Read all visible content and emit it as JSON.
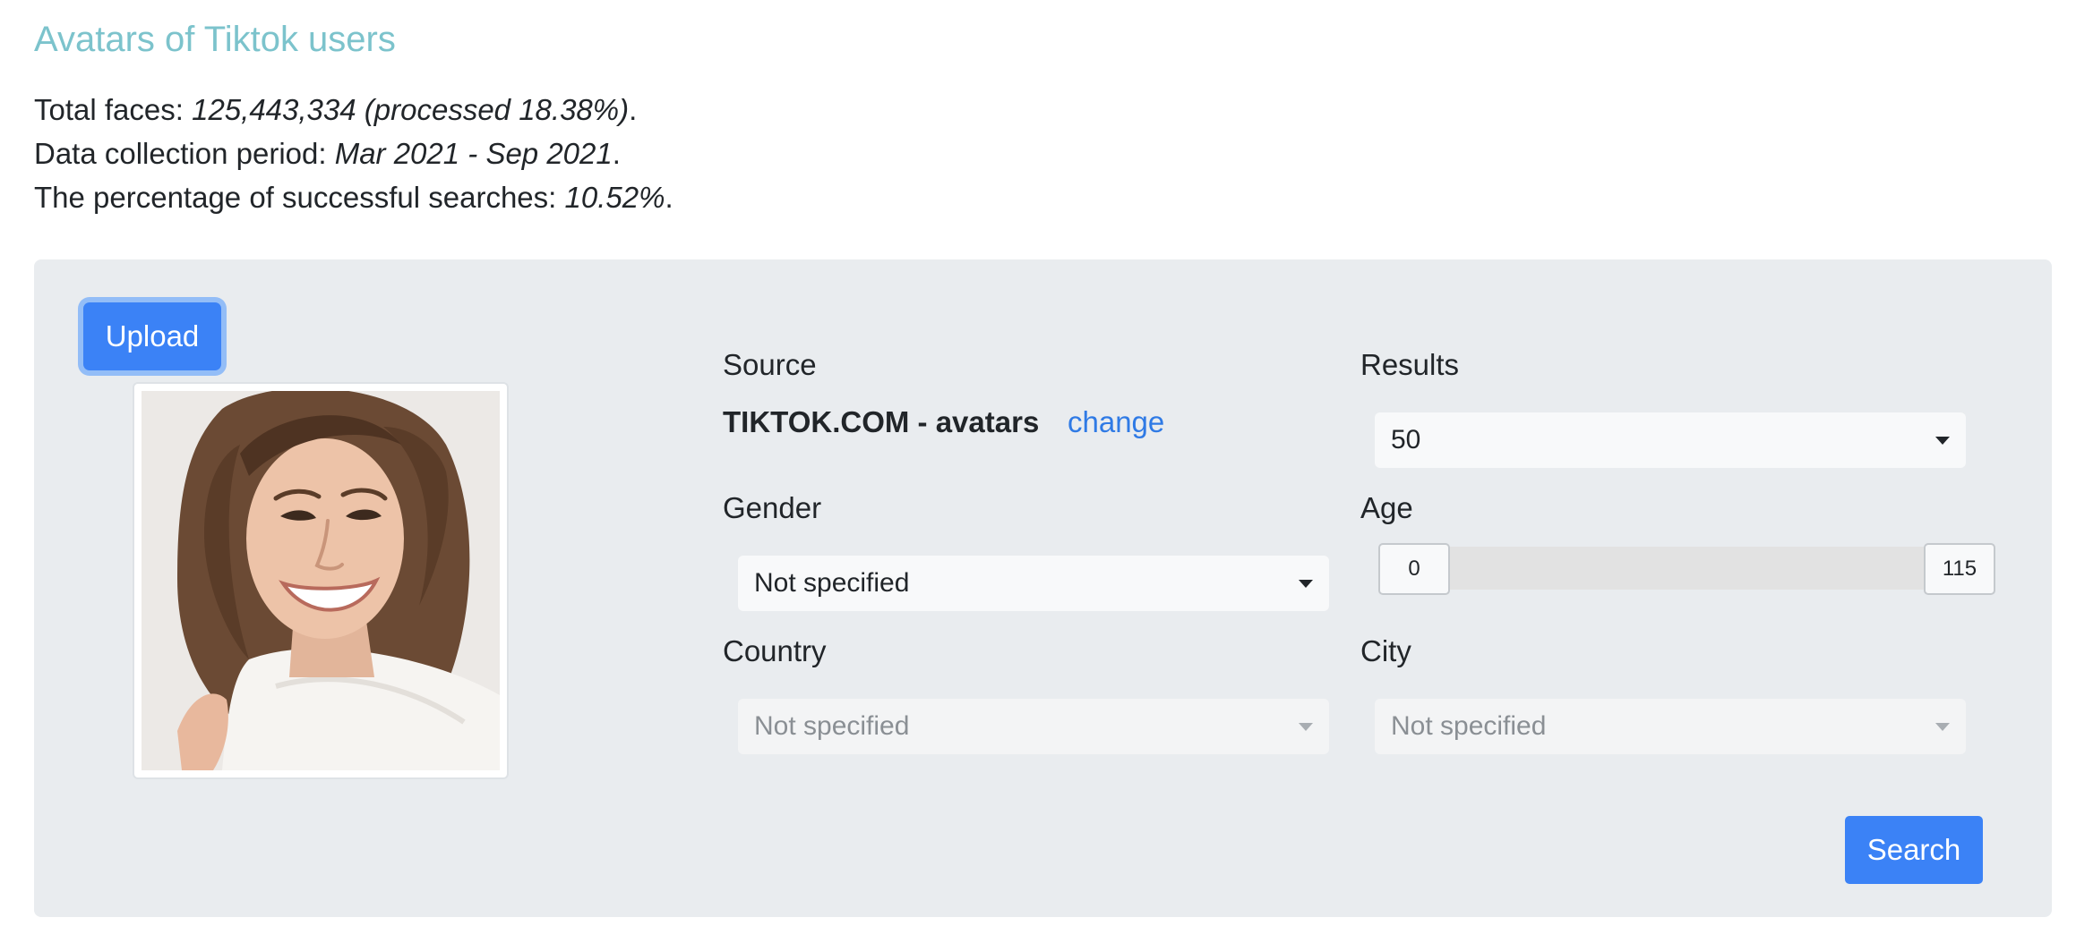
{
  "page": {
    "title": "Avatars of Tiktok users",
    "stats": [
      {
        "label": "Total faces: ",
        "value": "125,443,334 (processed 18.38%)",
        "suffix": "."
      },
      {
        "label": "Data collection period: ",
        "value": "Mar 2021 - Sep 2021",
        "suffix": "."
      },
      {
        "label": "The percentage of successful searches: ",
        "value": "10.52%",
        "suffix": "."
      }
    ]
  },
  "search_panel": {
    "upload_label": "Upload",
    "source": {
      "label": "Source",
      "value": "TIKTOK.COM - avatars",
      "change_label": "change"
    },
    "results": {
      "label": "Results",
      "selected": "50"
    },
    "gender": {
      "label": "Gender",
      "selected": "Not specified"
    },
    "age": {
      "label": "Age",
      "min": "0",
      "max": "115"
    },
    "country": {
      "label": "Country",
      "selected": "Not specified"
    },
    "city": {
      "label": "City",
      "selected": "Not specified"
    },
    "search_label": "Search"
  },
  "colors": {
    "title": "#7cc3cc",
    "panel_background": "#e9ecef",
    "primary_button": "#3b82f6",
    "link": "#2f7ae5"
  },
  "icons": {
    "select_caret": "caret-down-icon"
  }
}
